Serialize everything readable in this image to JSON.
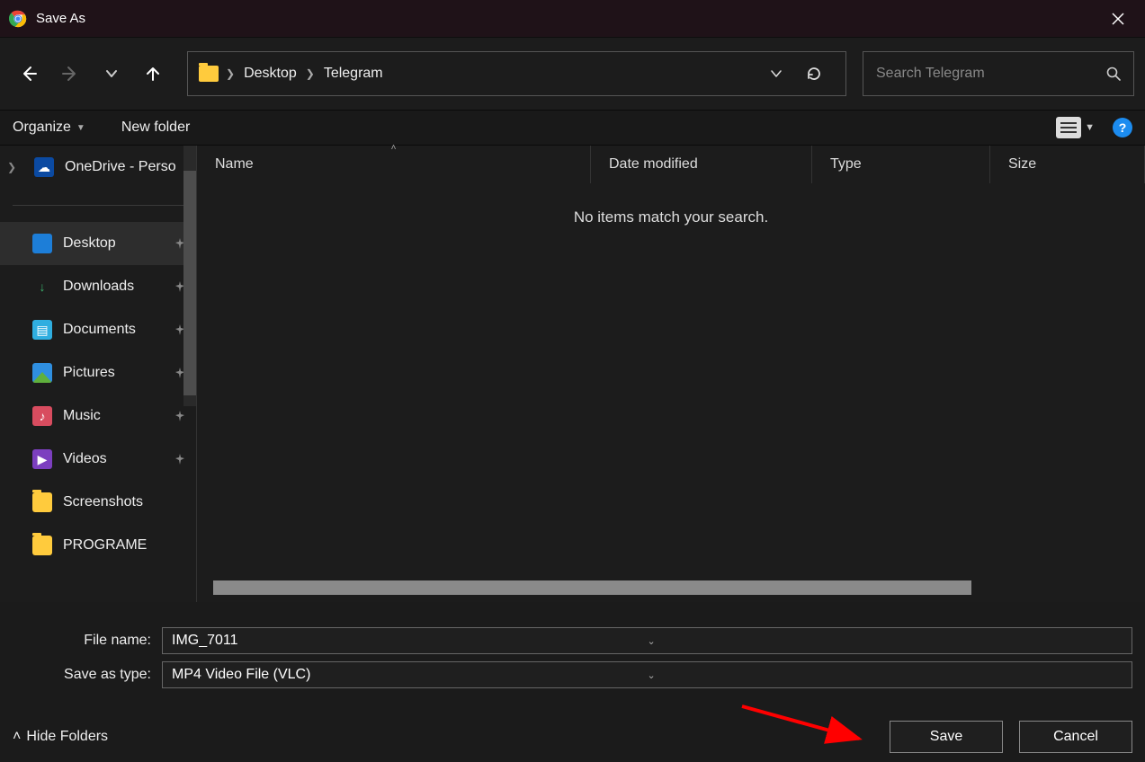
{
  "title": "Save As",
  "breadcrumb": {
    "seg1": "Desktop",
    "seg2": "Telegram"
  },
  "search": {
    "placeholder": "Search Telegram"
  },
  "toolbar": {
    "organize": "Organize",
    "newfolder": "New folder"
  },
  "sidebar": {
    "onedrive": "OneDrive - Perso",
    "items": [
      {
        "label": "Desktop",
        "icon": "ico-desktop",
        "pinned": true,
        "active": true
      },
      {
        "label": "Downloads",
        "icon": "ico-download",
        "pinned": true
      },
      {
        "label": "Documents",
        "icon": "ico-document",
        "pinned": true
      },
      {
        "label": "Pictures",
        "icon": "ico-picture",
        "pinned": true
      },
      {
        "label": "Music",
        "icon": "ico-music",
        "pinned": true
      },
      {
        "label": "Videos",
        "icon": "ico-video",
        "pinned": true
      },
      {
        "label": "Screenshots",
        "icon": "ico-folder",
        "pinned": false
      },
      {
        "label": "PROGRAME",
        "icon": "ico-folder",
        "pinned": false
      }
    ]
  },
  "columns": {
    "name": "Name",
    "date": "Date modified",
    "type": "Type",
    "size": "Size"
  },
  "empty": "No items match your search.",
  "filename_label": "File name:",
  "filename_value": "IMG_7011",
  "savetype_label": "Save as type:",
  "savetype_value": "MP4 Video File (VLC)",
  "hide_folders": "Hide Folders",
  "save_btn": "Save",
  "cancel_btn": "Cancel"
}
